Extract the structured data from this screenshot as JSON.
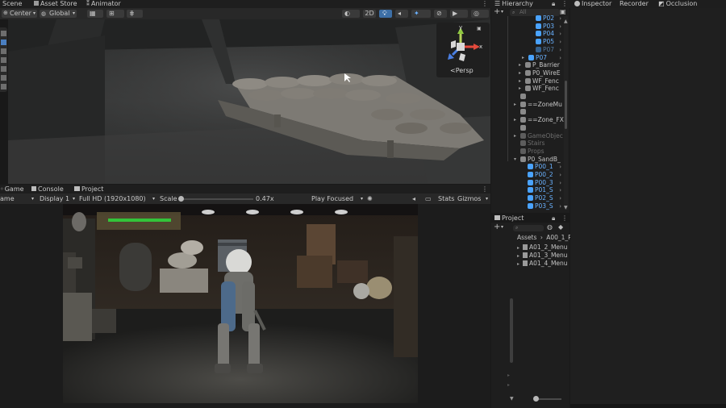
{
  "top_tabs": {
    "scene": "Scene",
    "asset_store": "Asset Store",
    "animator": "Animator",
    "hierarchy": "Hierarchy",
    "inspector": "Inspector",
    "recorder": "Recorder",
    "occlusion": "Occlusion"
  },
  "scene_toolbar": {
    "pivot_center": "Center",
    "pivot_global": "Global",
    "mode_2d": "2D"
  },
  "gizmo": {
    "persp_label": "<Persp",
    "axis_x": "x",
    "axis_y": "y"
  },
  "game_tabs": {
    "game": "Game",
    "console": "Console",
    "project": "Project"
  },
  "game_toolbar": {
    "view": "ame",
    "display": "Display 1",
    "resolution": "Full HD (1920x1080)",
    "scale_label": "Scale",
    "scale_value": "0.47x",
    "play_mode": "Play Focused",
    "stats": "Stats",
    "gizmos": "Gizmos"
  },
  "hierarchy": {
    "search_placeholder": "All",
    "items": [
      {
        "label": "P02",
        "style": "blue"
      },
      {
        "label": "P03",
        "style": "blue"
      },
      {
        "label": "P04",
        "style": "blue"
      },
      {
        "label": "P05",
        "style": "blue"
      },
      {
        "label": "P07",
        "style": "dimblue"
      },
      {
        "label": "P07",
        "style": "blue"
      },
      {
        "label": "P_Barrier",
        "style": "normal"
      },
      {
        "label": "P0_WireE",
        "style": "normal"
      },
      {
        "label": "WF_Fenc",
        "style": "normal"
      },
      {
        "label": "WF_Fenc",
        "style": "normal"
      },
      {
        "label": "",
        "style": "normal"
      },
      {
        "label": "==ZoneMu",
        "style": "normal"
      },
      {
        "label": "",
        "style": "normal"
      },
      {
        "label": "==Zone_FX",
        "style": "normal"
      },
      {
        "label": "",
        "style": "normal"
      },
      {
        "label": "GameObjec",
        "style": "dim"
      },
      {
        "label": "Stairs",
        "style": "dim"
      },
      {
        "label": "Props",
        "style": "dim"
      },
      {
        "label": "P0_SandB_",
        "style": "normal"
      },
      {
        "label": "P00_1",
        "style": "blue"
      },
      {
        "label": "P00_2",
        "style": "blue"
      },
      {
        "label": "P00_3",
        "style": "blue"
      },
      {
        "label": "P01_S",
        "style": "blue"
      },
      {
        "label": "P02_S",
        "style": "blue"
      },
      {
        "label": "P03_S",
        "style": "blue"
      }
    ]
  },
  "project": {
    "tab": "Project",
    "breadcrumb_root": "Assets",
    "breadcrumb_folder": "A00_1_R",
    "items": [
      "A01_2_Menu",
      "A01_3_Menu",
      "A01_4_Menu"
    ]
  },
  "colors": {
    "accent": "#4aa3ff",
    "health_bar": "#33c43a"
  }
}
